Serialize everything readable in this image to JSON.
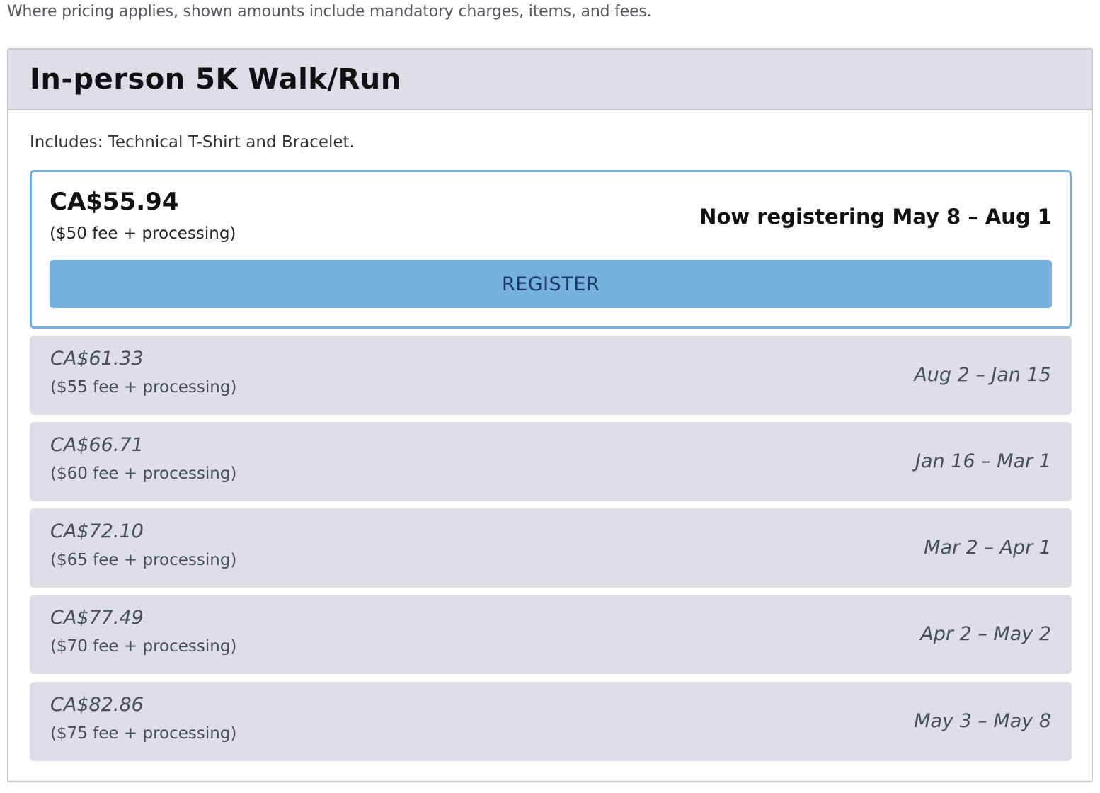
{
  "disclaimer": "Where pricing applies, shown amounts include mandatory charges, items, and fees.",
  "event": {
    "title": "In-person 5K Walk/Run",
    "includes": "Includes: Technical T-Shirt and Bracelet."
  },
  "active_tier": {
    "price": "CA$55.94",
    "fee": "($50 fee + processing)",
    "dates": "Now registering May 8 – Aug 1",
    "register_label": "REGISTER"
  },
  "tiers": [
    {
      "price": "CA$61.33",
      "fee": "($55 fee + processing)",
      "dates": "Aug 2 – Jan 15"
    },
    {
      "price": "CA$66.71",
      "fee": "($60 fee + processing)",
      "dates": "Jan 16 – Mar 1"
    },
    {
      "price": "CA$72.10",
      "fee": "($65 fee + processing)",
      "dates": "Mar 2 – Apr 1"
    },
    {
      "price": "CA$77.49",
      "fee": "($70 fee + processing)",
      "dates": "Apr 2 – May 2"
    },
    {
      "price": "CA$82.86",
      "fee": "($75 fee + processing)",
      "dates": "May 3 – May 8"
    }
  ],
  "colors": {
    "accent": "#76b0dd",
    "header_bg": "#dedee6",
    "tier_bg": "#dedee6"
  }
}
